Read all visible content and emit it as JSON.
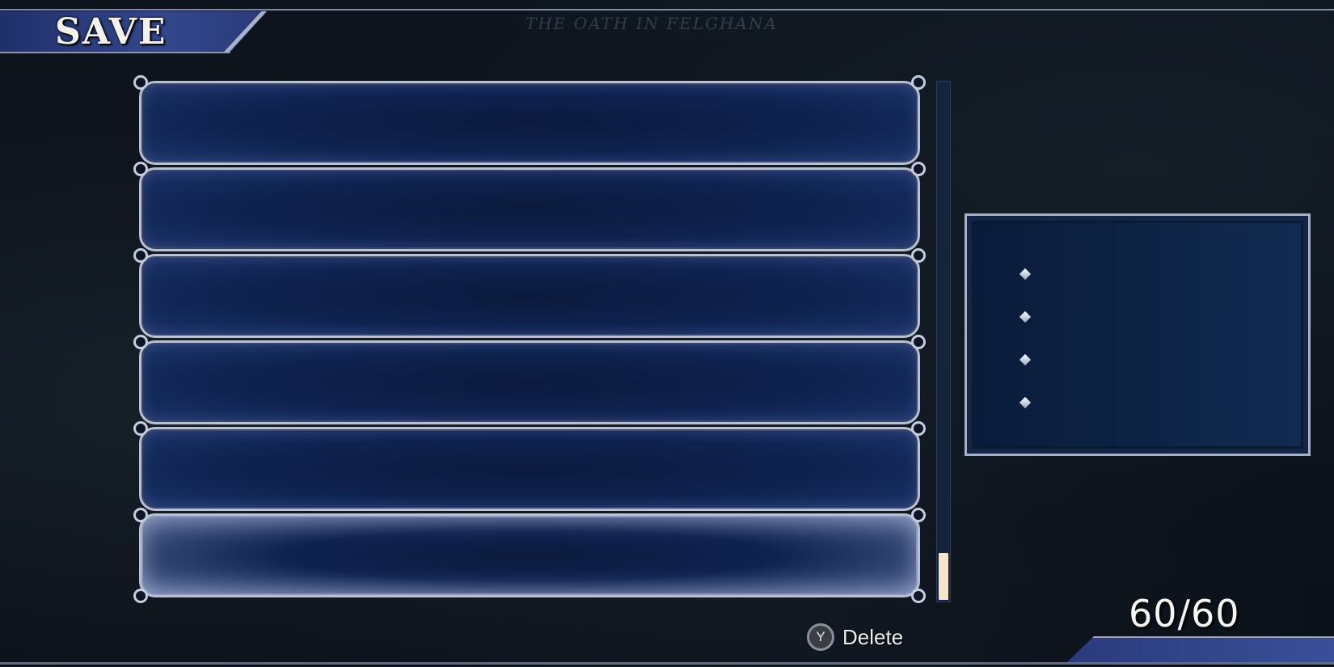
{
  "screen": {
    "title": "SAVE",
    "subtitle": "THE OATH IN FELGHANA"
  },
  "slots": [
    {
      "label": ""
    },
    {
      "label": ""
    },
    {
      "label": ""
    },
    {
      "label": ""
    },
    {
      "label": ""
    },
    {
      "label": "",
      "selected": true
    }
  ],
  "scrollbar": {
    "position": "bottom"
  },
  "info_panel": {
    "bullets": [
      "",
      "",
      "",
      ""
    ]
  },
  "controls": {
    "delete_button": "Y",
    "delete_label": "Delete"
  },
  "save_count": "60/60",
  "colors": {
    "slot_border": "#b9c0d4",
    "slot_fill": "#0f2350",
    "banner": "#33478d",
    "scroll_thumb": "#f6e3cc"
  }
}
